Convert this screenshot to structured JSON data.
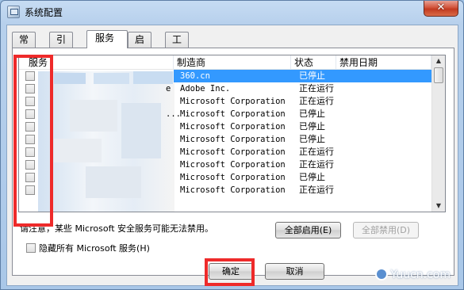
{
  "window": {
    "title": "系统配置",
    "close_glyph": "✕"
  },
  "tabs": [
    {
      "label": "常规",
      "active": false
    },
    {
      "label": "引导",
      "active": false
    },
    {
      "label": "服务",
      "active": true
    },
    {
      "label": "启动",
      "active": false
    },
    {
      "label": "工具",
      "active": false
    }
  ],
  "table": {
    "headers": {
      "service": "服务",
      "manufacturer": "制造商",
      "status": "状态",
      "disabled_date": "禁用日期"
    },
    "rows": [
      {
        "service_tail": "",
        "manufacturer": "360.cn",
        "status": "已停止",
        "selected": true
      },
      {
        "service_tail": "e",
        "manufacturer": "Adobe Inc.",
        "status": "正在运行",
        "selected": false
      },
      {
        "service_tail": "",
        "manufacturer": "Microsoft Corporation",
        "status": "正在运行",
        "selected": false
      },
      {
        "service_tail": "...",
        "manufacturer": "Microsoft Corporation",
        "status": "已停止",
        "selected": false
      },
      {
        "service_tail": "",
        "manufacturer": "Microsoft Corporation",
        "status": "已停止",
        "selected": false
      },
      {
        "service_tail": "",
        "manufacturer": "Microsoft Corporation",
        "status": "已停止",
        "selected": false
      },
      {
        "service_tail": "",
        "manufacturer": "Microsoft Corporation",
        "status": "正在运行",
        "selected": false
      },
      {
        "service_tail": "",
        "manufacturer": "Microsoft Corporation",
        "status": "正在运行",
        "selected": false
      },
      {
        "service_tail": "",
        "manufacturer": "Microsoft Corporation",
        "status": "已停止",
        "selected": false
      },
      {
        "service_tail": "",
        "manufacturer": "Microsoft Corporation",
        "status": "正在运行",
        "selected": false
      }
    ]
  },
  "note": {
    "prefix": "请注意，",
    "text": "某些 Microsoft 安全服务可能无法禁用。"
  },
  "buttons": {
    "enable_all": "全部启用(E)",
    "disable_all": "全部禁用(D)",
    "ok": "确定",
    "cancel": "取消"
  },
  "hide_ms": {
    "label": "隐藏所有 Microsoft 服务(H)"
  },
  "watermark": {
    "text": "Yuucn.com"
  },
  "colors": {
    "selection": "#3399ff",
    "highlight_box": "#ee2a2a"
  }
}
